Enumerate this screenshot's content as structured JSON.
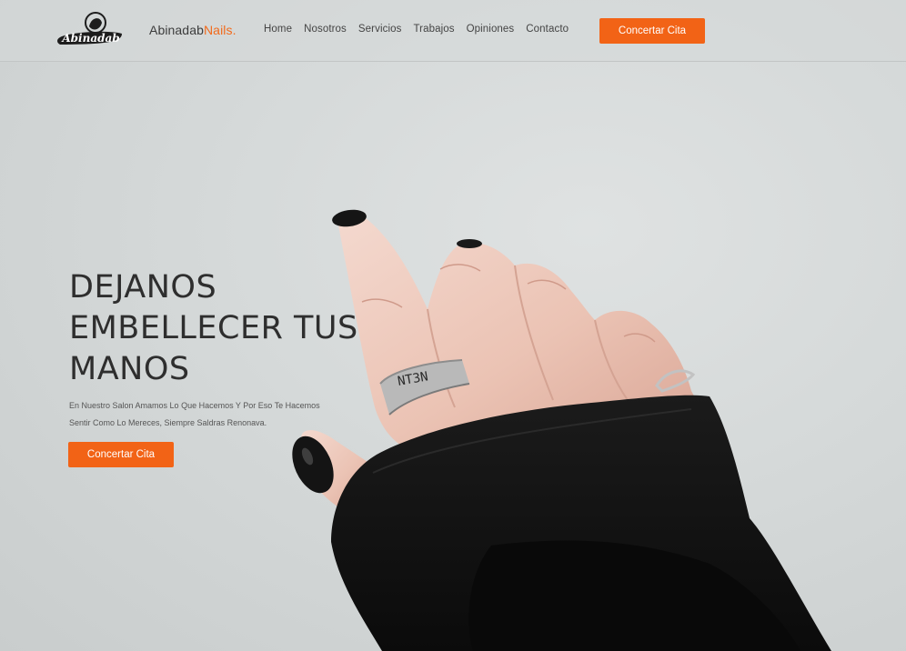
{
  "brand": {
    "name": "Abinadab",
    "accent": "Nails.",
    "logo_text": "Abinadab"
  },
  "nav": {
    "items": [
      "Home",
      "Nosotros",
      "Servicios",
      "Trabajos",
      "Opiniones",
      "Contacto"
    ],
    "cta_label": "Concertar Cita"
  },
  "hero": {
    "title_lines": [
      "DEJANOS",
      "EMBELLECER TUS",
      "MANOS"
    ],
    "subtitle_lines": [
      "En Nuestro Salon Amamos Lo Que Hacemos Y Por Eso Te Hacemos",
      "Sentir Como Lo Mereces, Siempre Saldras Renonava."
    ],
    "cta_label": "Concertar Cita",
    "ring_text": "NT3N"
  },
  "colors": {
    "accent": "#f26316",
    "text": "#2e2e2e",
    "background": "#d8dcdc"
  }
}
